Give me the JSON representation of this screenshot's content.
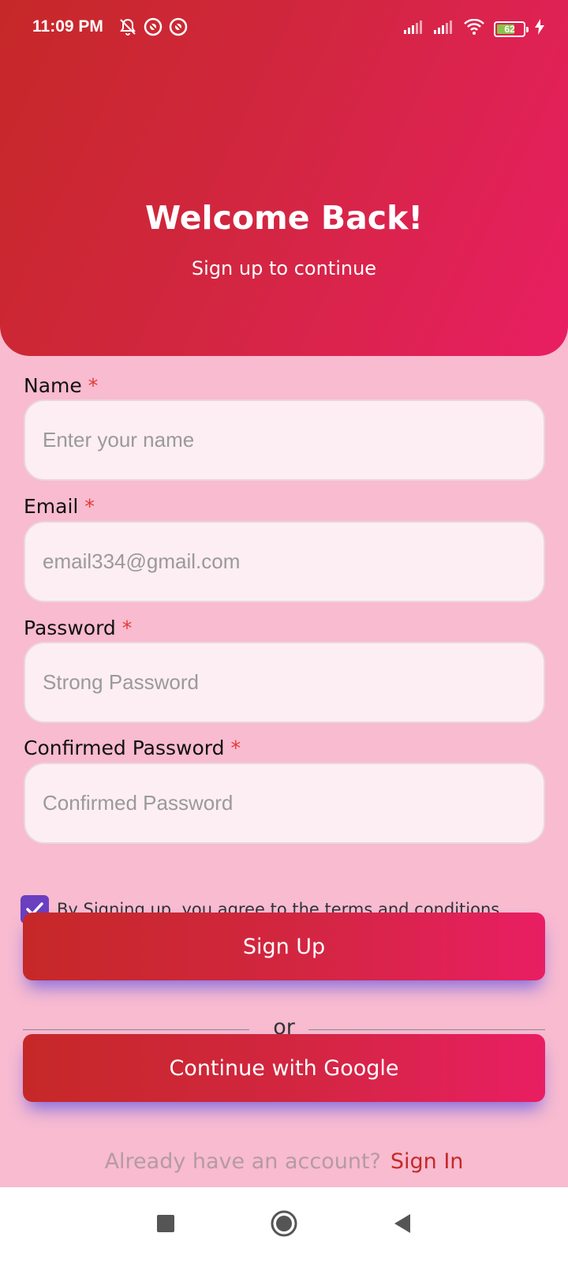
{
  "status_bar": {
    "time": "11:09 PM",
    "battery": "62",
    "left_icons": [
      "bell-off-icon",
      "app-notification-icon",
      "app-notification-icon"
    ],
    "right_icons": [
      "signal-icon",
      "signal-icon",
      "wifi-icon",
      "battery-icon",
      "charging-bolt-icon"
    ]
  },
  "header": {
    "title": "Welcome Back!",
    "subtitle": "Sign up to continue"
  },
  "form": {
    "required_mark": "*",
    "name": {
      "label": "Name",
      "placeholder": "Enter your name",
      "value": ""
    },
    "email": {
      "label": "Email",
      "placeholder": "email334@gmail.com",
      "value": ""
    },
    "password": {
      "label": "Password",
      "placeholder": "Strong Password",
      "value": ""
    },
    "confirm": {
      "label": "Confirmed Password",
      "placeholder": "Confirmed Password",
      "value": ""
    },
    "terms": {
      "text": "By Signing up, you agree to the terms and conditions.",
      "checked": true
    }
  },
  "actions": {
    "signup_label": "Sign Up",
    "divider_text": "or",
    "google_label": "Continue with Google",
    "signin_prompt": "Already have an account?",
    "signin_link": "Sign In"
  },
  "nav": {
    "icons": [
      "recent-apps-icon",
      "home-icon",
      "back-icon"
    ]
  },
  "colors": {
    "gradient_start": "#c62828",
    "gradient_end": "#e91e63",
    "background": "#f8bbd0",
    "checkbox": "#6a3fc0",
    "required": "#e53935",
    "link": "#c62828"
  }
}
